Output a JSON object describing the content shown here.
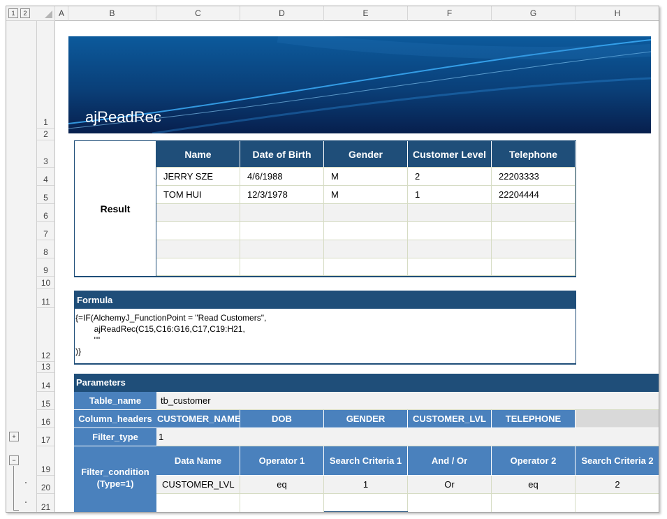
{
  "outline_levels": [
    "1",
    "2"
  ],
  "outline_buttons": {
    "expand": "+",
    "collapse": "−"
  },
  "columns": [
    "A",
    "B",
    "C",
    "D",
    "E",
    "F",
    "G",
    "H"
  ],
  "rows": [
    "1",
    "2",
    "3",
    "4",
    "5",
    "6",
    "7",
    "8",
    "9",
    "10",
    "11",
    "12",
    "13",
    "14",
    "15",
    "16",
    "17",
    "19",
    "20",
    "21"
  ],
  "banner_title": "ajReadRec",
  "result": {
    "label": "Result",
    "headers": [
      "Name",
      "Date of Birth",
      "Gender",
      "Customer Level",
      "Telephone"
    ],
    "rows": [
      [
        "JERRY SZE",
        "4/6/1988",
        "M",
        "2",
        "22203333"
      ],
      [
        "TOM HUI",
        "12/3/1978",
        "M",
        "1",
        "22204444"
      ]
    ]
  },
  "formula": {
    "title": "Formula",
    "lines": [
      "{=IF(AlchemyJ_FunctionPoint = \"Read Customers\",",
      "        ajReadRec(C15,C16:G16,C17,C19:H21,",
      "        \"\"",
      ")}"
    ]
  },
  "parameters": {
    "title": "Parameters",
    "table_name_label": "Table_name",
    "table_name_value": "tb_customer",
    "column_headers_label": "Column_headers",
    "column_headers": [
      "CUSTOMER_NAME",
      "DOB",
      "GENDER",
      "CUSTOMER_LVL",
      "TELEPHONE"
    ],
    "filter_type_label": "Filter_type",
    "filter_type_value": "1",
    "filter_condition_label_1": "Filter_condition",
    "filter_condition_label_2": "(Type=1)",
    "condition_headers": [
      "Data Name",
      "Operator 1",
      "Search Criteria 1",
      "And / Or",
      "Operator 2",
      "Search Criteria 2"
    ],
    "condition_rows": [
      [
        "CUSTOMER_LVL",
        "eq",
        "1",
        "Or",
        "eq",
        "2"
      ]
    ]
  }
}
